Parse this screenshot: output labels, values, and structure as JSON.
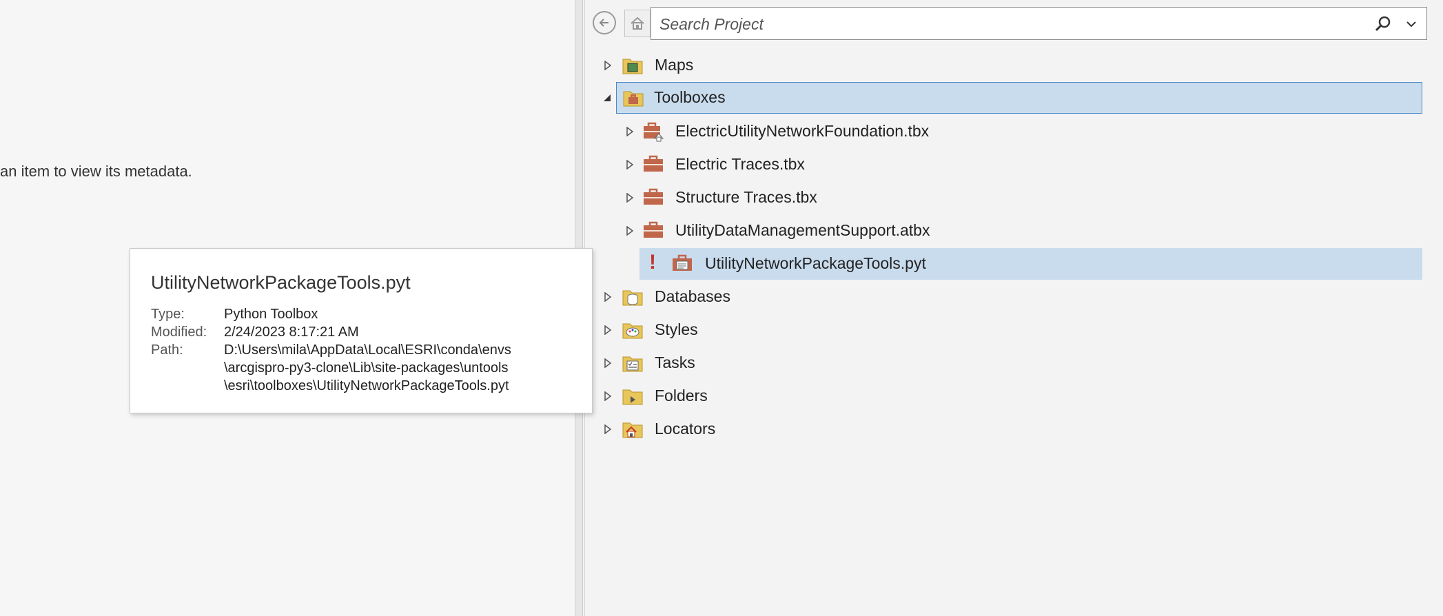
{
  "metadata_pane": {
    "hint": "an item to view its metadata."
  },
  "search": {
    "placeholder": "Search Project"
  },
  "tree": {
    "maps": "Maps",
    "toolboxes": "Toolboxes",
    "toolbox_items": [
      "ElectricUtilityNetworkFoundation.tbx",
      "Electric Traces.tbx",
      "Structure Traces.tbx",
      "UtilityDataManagementSupport.atbx",
      "UtilityNetworkPackageTools.pyt"
    ],
    "warning_mark": "!",
    "databases": "Databases",
    "styles": "Styles",
    "tasks": "Tasks",
    "folders": "Folders",
    "locators": "Locators"
  },
  "tooltip": {
    "title": "UtilityNetworkPackageTools.pyt",
    "type_key": "Type:",
    "type_val": "Python Toolbox",
    "modified_key": "Modified:",
    "modified_val": "2/24/2023 8:17:21 AM",
    "path_key": "Path:",
    "path_line1": "D:\\Users\\mila\\AppData\\Local\\ESRI\\conda\\envs",
    "path_line2": "\\arcgispro-py3-clone\\Lib\\site-packages\\untools",
    "path_line3": "\\esri\\toolboxes\\UtilityNetworkPackageTools.pyt"
  },
  "colors": {
    "selection": "#c9dcee",
    "selection_border": "#4a89c8",
    "folder": "#e8c65a",
    "toolbox": "#c0664a",
    "warning": "#c0392b"
  },
  "icons": {
    "back": "back-arrow-icon",
    "home": "home-icon",
    "search": "search-icon",
    "dropdown": "chevron-down-icon",
    "folder": "folder-icon",
    "toolbox": "toolbox-icon"
  }
}
